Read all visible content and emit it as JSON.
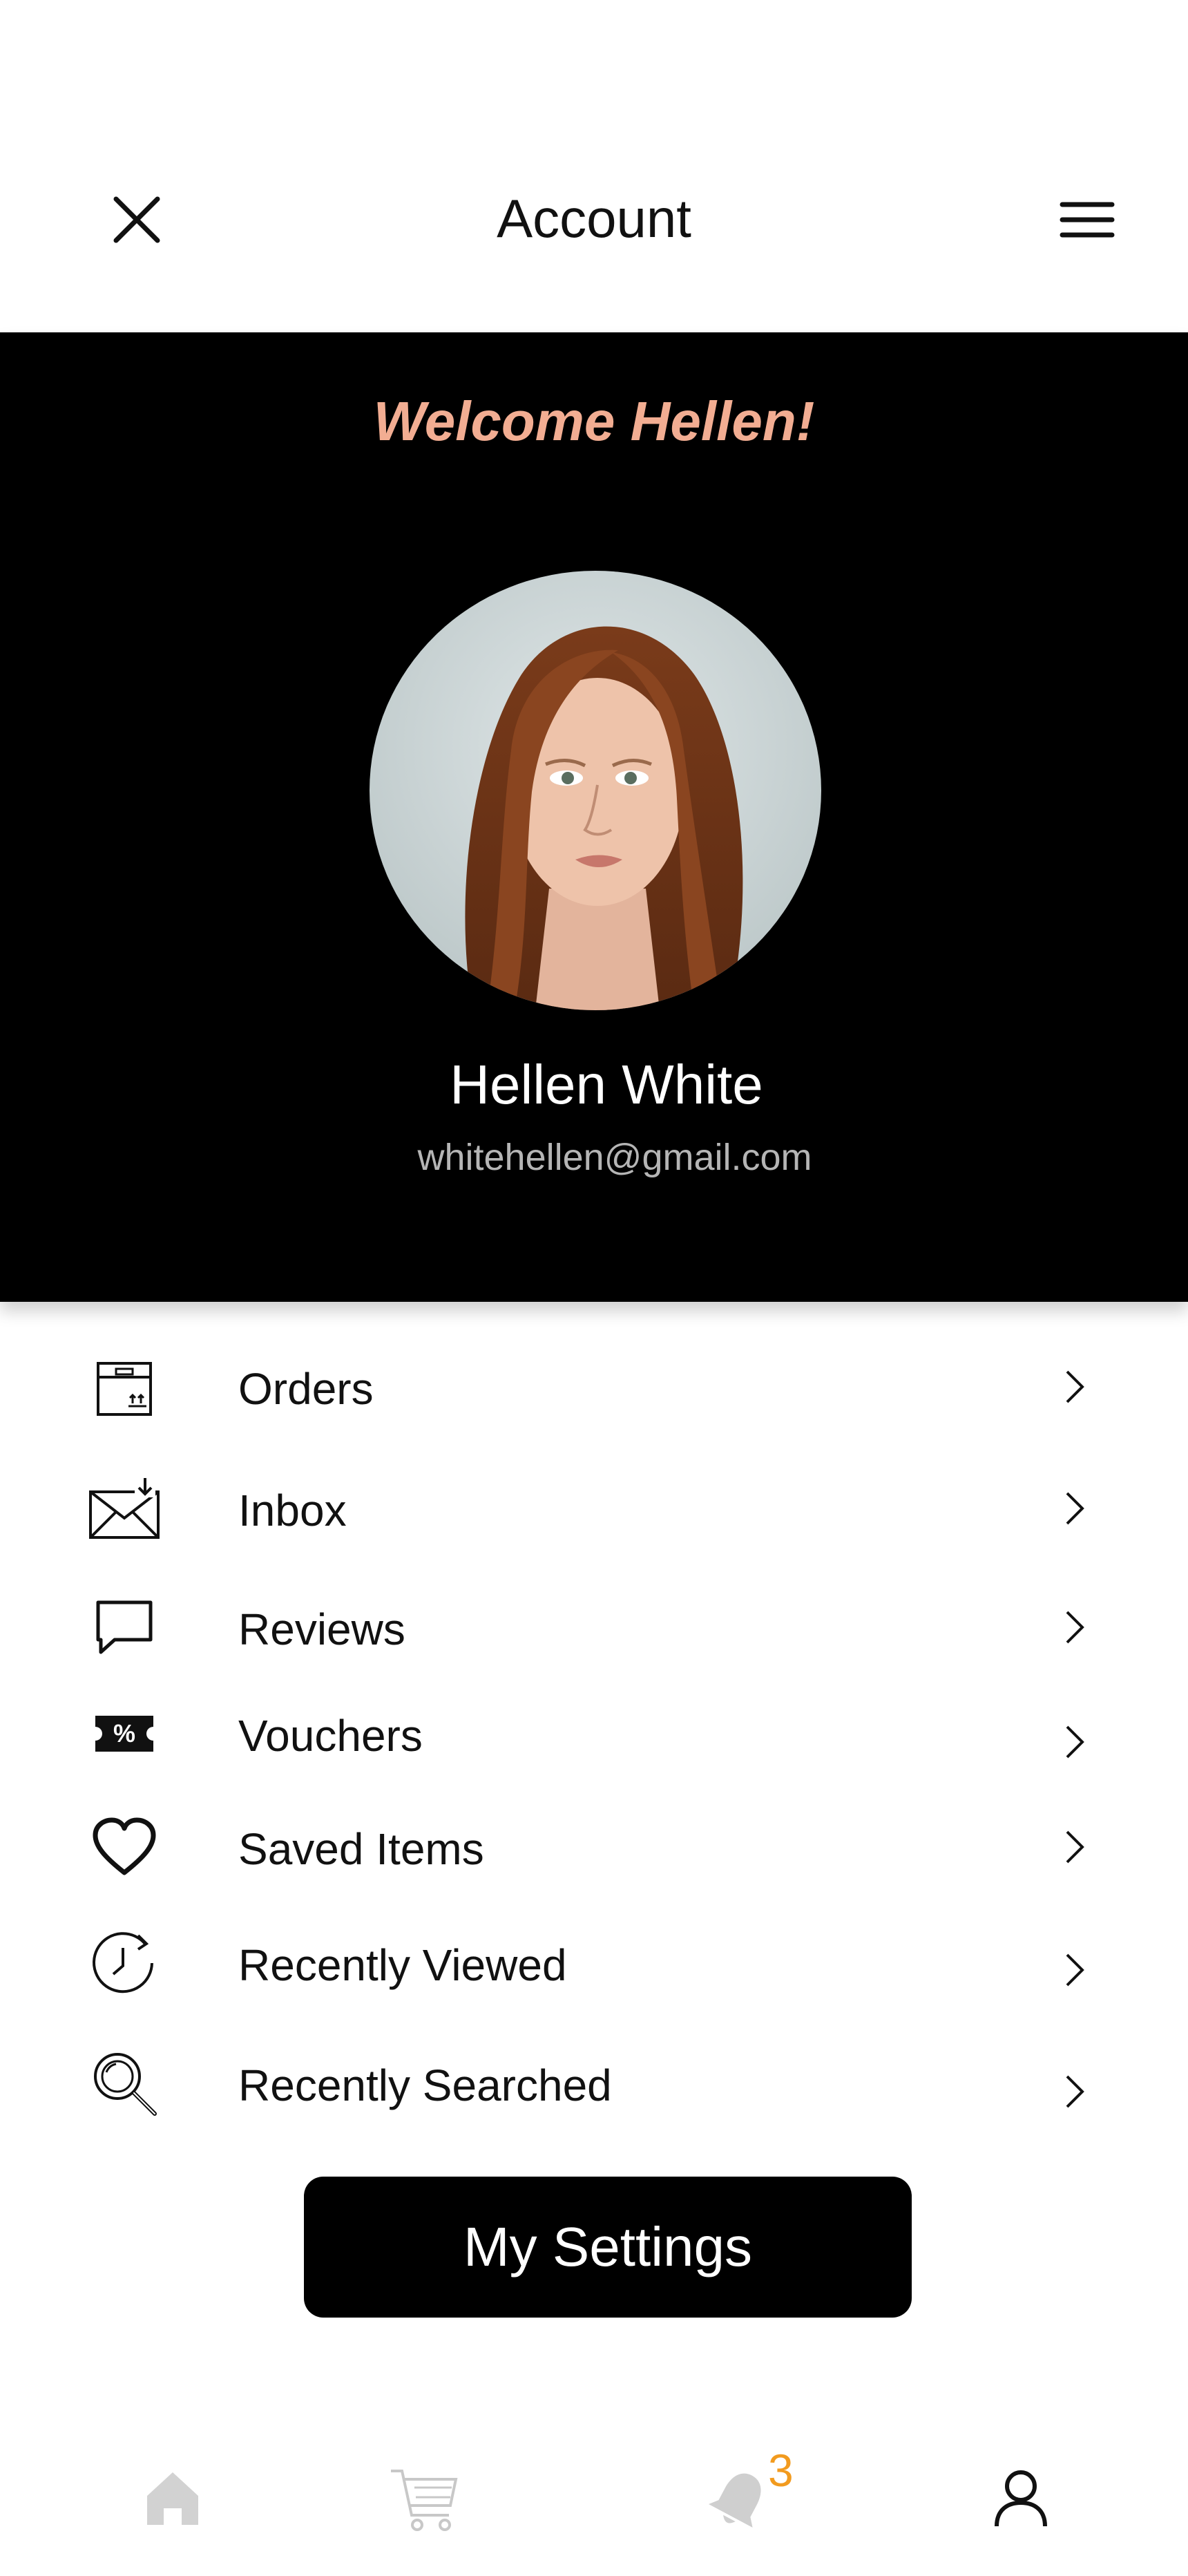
{
  "header": {
    "title": "Account",
    "close_icon": "close-icon",
    "menu_icon": "hamburger-menu-icon"
  },
  "profile": {
    "welcome": "Welcome Hellen!",
    "name": "Hellen White",
    "email": "whitehellen@gmail.com",
    "welcome_color": "#f2ad92",
    "background_color": "#000000"
  },
  "menu": {
    "items": [
      {
        "label": "Orders",
        "icon": "package-box-icon"
      },
      {
        "label": "Inbox",
        "icon": "envelope-download-icon"
      },
      {
        "label": "Reviews",
        "icon": "speech-bubble-icon"
      },
      {
        "label": "Vouchers",
        "icon": "percent-ticket-icon"
      },
      {
        "label": "Saved Items",
        "icon": "heart-icon"
      },
      {
        "label": "Recently Viewed",
        "icon": "clock-history-icon"
      },
      {
        "label": "Recently Searched",
        "icon": "magnifier-icon"
      }
    ]
  },
  "settings_button": {
    "label": "My Settings"
  },
  "bottom_nav": {
    "items": [
      {
        "name": "home",
        "icon": "home-icon"
      },
      {
        "name": "cart",
        "icon": "cart-icon"
      },
      {
        "name": "notifications",
        "icon": "bell-icon"
      },
      {
        "name": "account",
        "icon": "user-icon"
      }
    ],
    "notification_count": "3",
    "badge_color": "#f29b1f"
  }
}
